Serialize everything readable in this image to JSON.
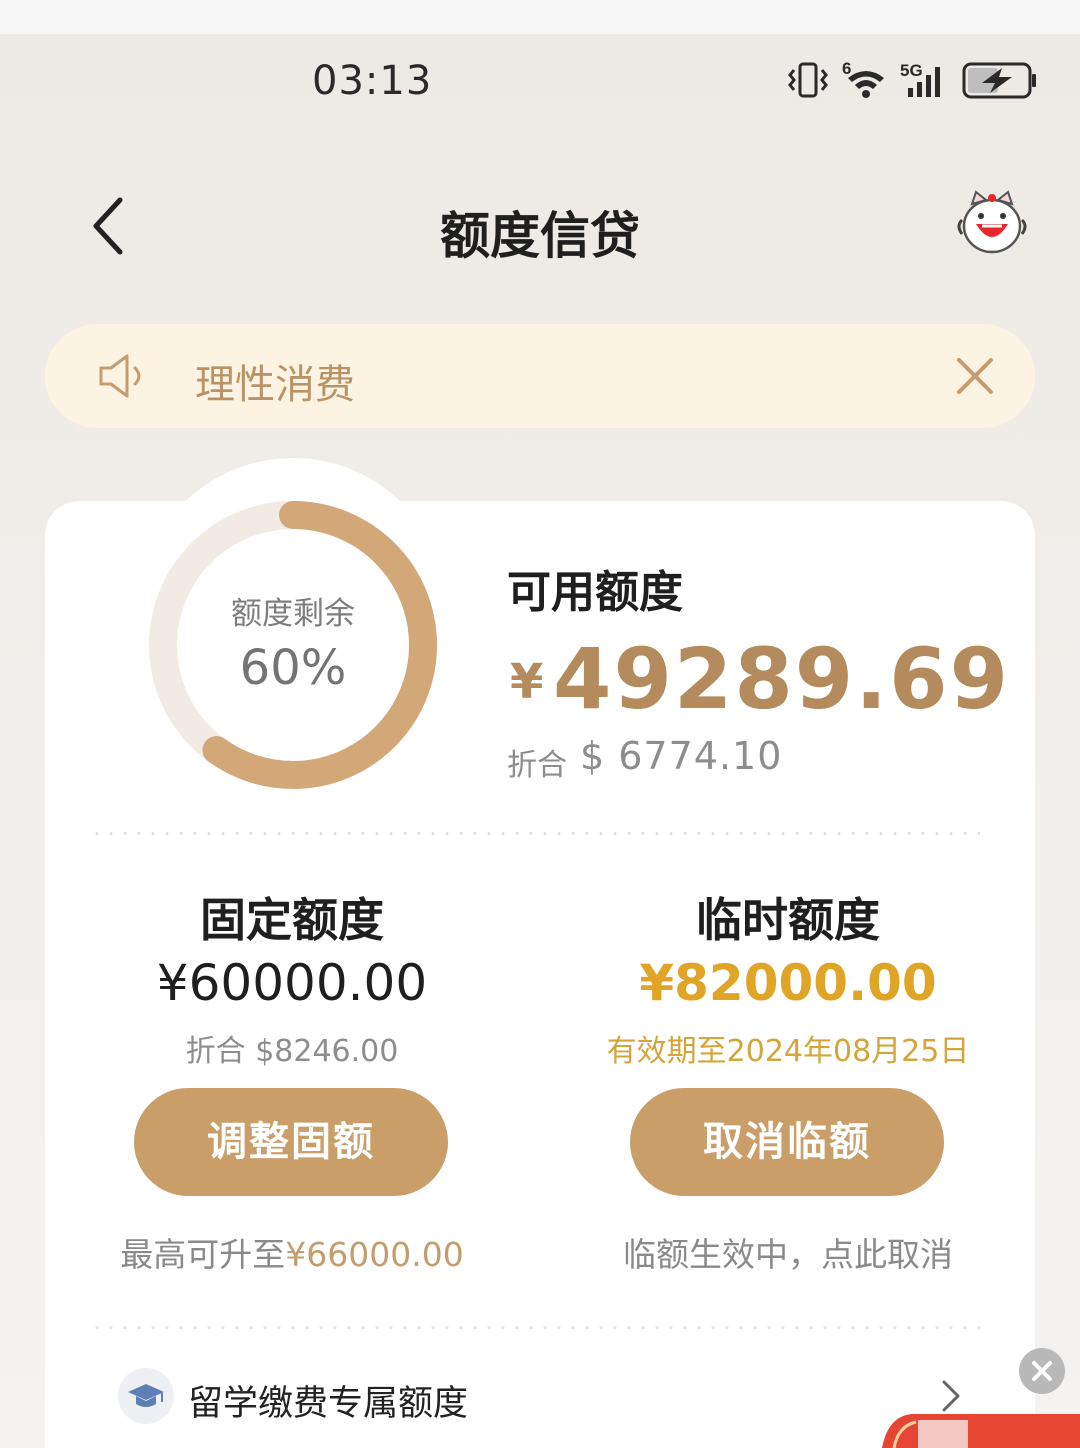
{
  "status_bar": {
    "time": "03:13",
    "icons": [
      "vibrate-icon",
      "wifi-icon",
      "signal-5g-icon",
      "battery-charging-icon"
    ],
    "wifi_label": "6",
    "network_label": "5G"
  },
  "nav": {
    "title": "额度信贷",
    "back_icon": "chevron-left-icon",
    "service_icon": "mascot-icon"
  },
  "notice": {
    "text": "理性消费",
    "icon": "speaker-icon",
    "close_icon": "close-icon"
  },
  "credit": {
    "ring_label": "额度剩余",
    "ring_value": "60%",
    "ring_fraction": 0.6,
    "available_label": "可用额度",
    "currency_symbol": "¥",
    "available_amount": "49289.69",
    "equiv_prefix": "折合",
    "equiv_amount": "$ 6774.10"
  },
  "fixed": {
    "title": "固定额度",
    "amount": "¥60000.00",
    "sub": "折合 $8246.00",
    "button": "调整固额",
    "note_prefix": "最高可升至",
    "note_value": "¥66000.00"
  },
  "temporary": {
    "title": "临时额度",
    "amount": "¥82000.00",
    "sub": "有效期至2024年08月25日",
    "button": "取消临额",
    "note": "临额生效中，点此取消"
  },
  "special": {
    "label": "留学缴费专属额度",
    "icon": "graduation-cap-icon",
    "arrow_icon": "chevron-right-icon"
  },
  "colors": {
    "accent": "#c99e69",
    "amount_gold": "#b38b5c",
    "temp_amount": "#e0a526",
    "notice_bg": "#fdf3e2",
    "notice_text": "#b99367"
  }
}
